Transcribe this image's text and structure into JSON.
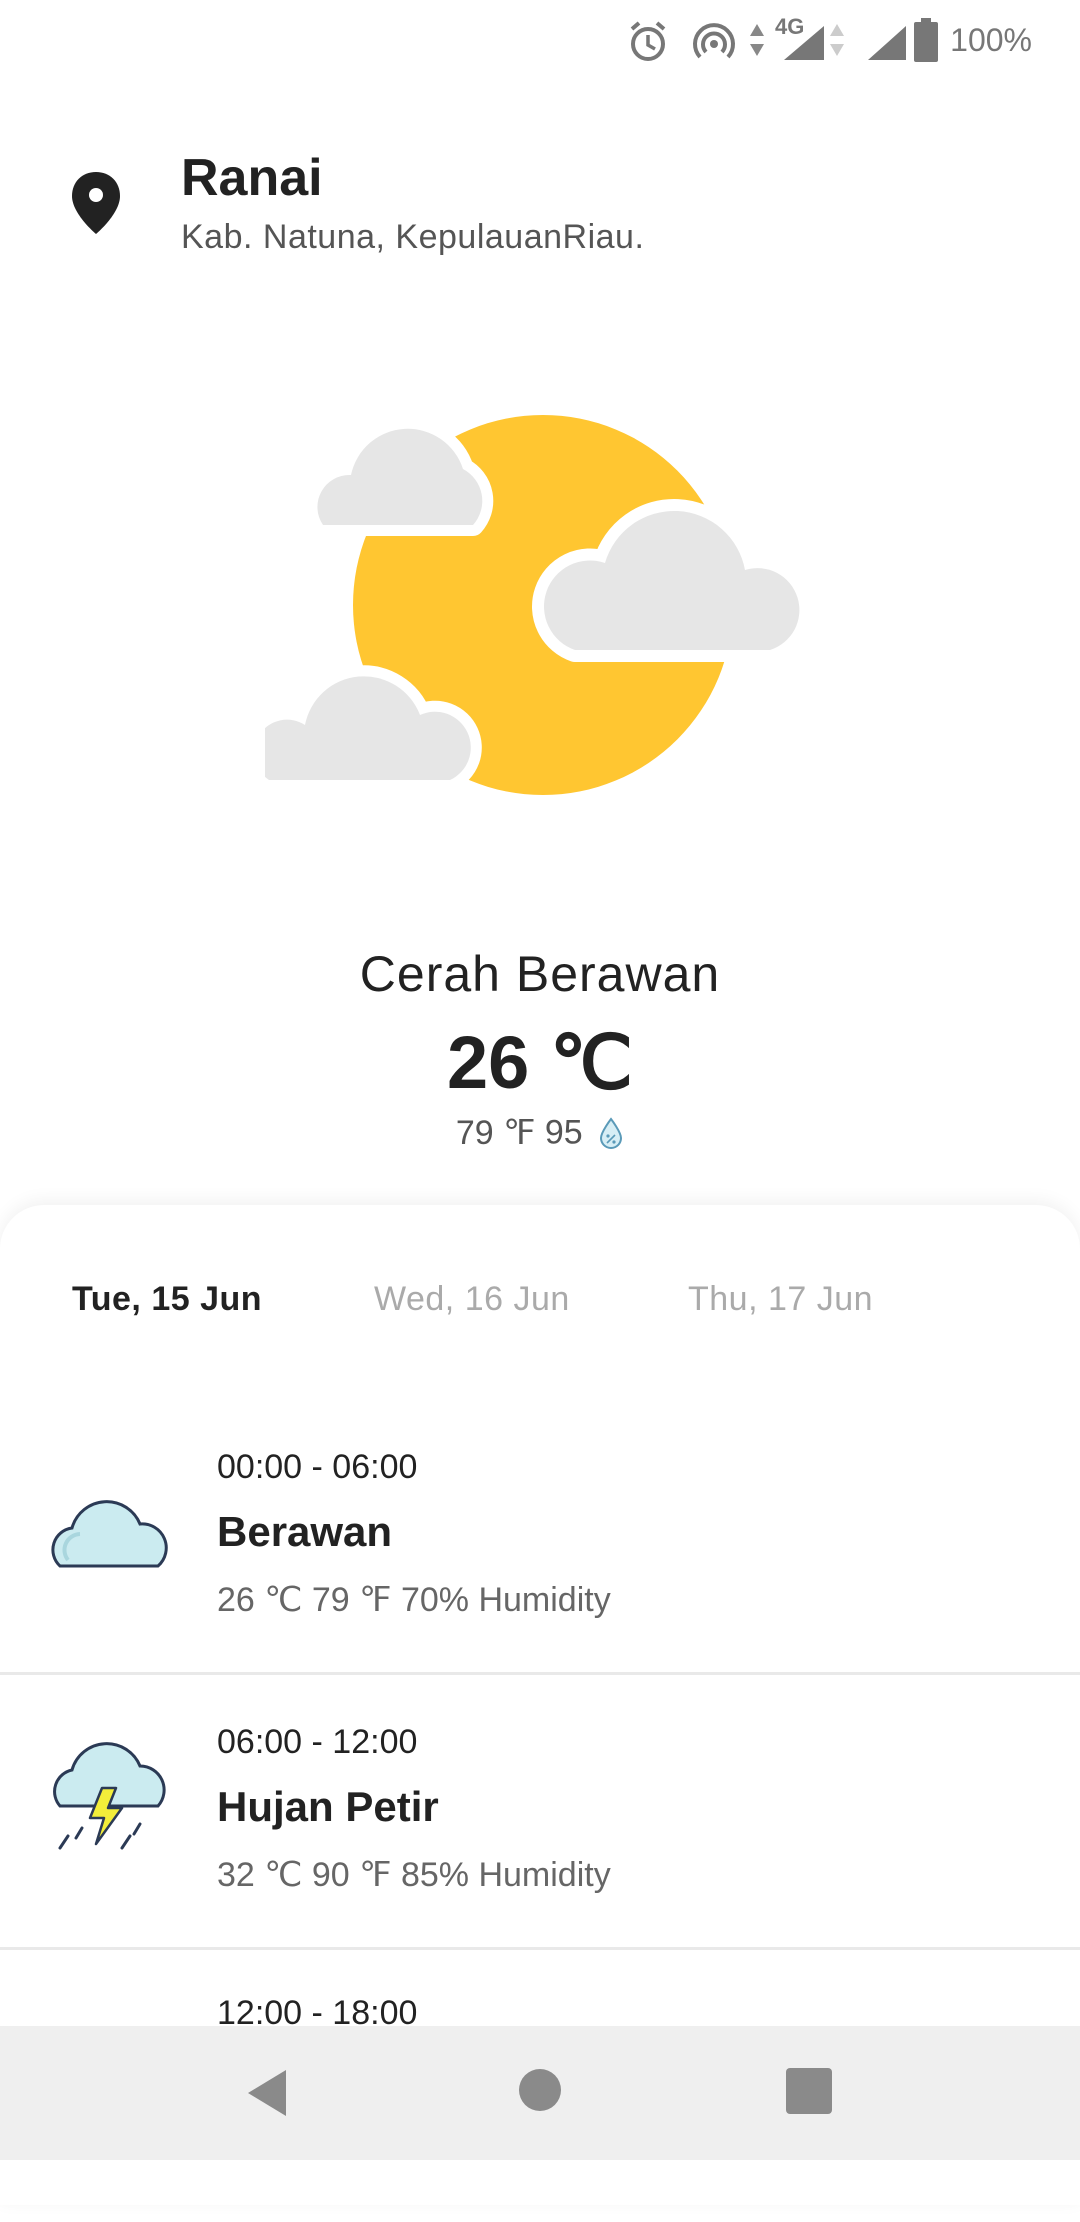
{
  "status_bar": {
    "network": "4G",
    "battery": "100%",
    "icons": [
      "alarm-icon",
      "hotspot-icon",
      "data-arrows-icon",
      "signal-icon",
      "battery-icon"
    ]
  },
  "location": {
    "city": "Ranai",
    "region": "Kab. Natuna, KepulauanRiau.",
    "icon": "map-pin-icon"
  },
  "current": {
    "icon": "partly-cloudy-sun-icon",
    "condition": "Cerah Berawan",
    "temp_c": "26 ℃",
    "temp_f": "79 ℉",
    "humidity": "95",
    "humidity_icon": "humidity-drop-icon"
  },
  "tabs": [
    {
      "label": "Tue, 15 Jun",
      "active": true
    },
    {
      "label": "Wed, 16 Jun",
      "active": false
    },
    {
      "label": "Thu, 17 Jun",
      "active": false
    }
  ],
  "forecast": [
    {
      "time": "00:00 - 06:00",
      "desc": "Berawan",
      "detail": "26 ℃ 79 ℉ 70% Humidity",
      "icon": "cloud-icon"
    },
    {
      "time": "06:00 - 12:00",
      "desc": "Hujan Petir",
      "detail": "32 ℃ 90 ℉ 85% Humidity",
      "icon": "thunderstorm-icon"
    },
    {
      "time": "12:00 - 18:00",
      "desc": "",
      "detail": "",
      "icon": "cloud-icon"
    }
  ],
  "nav": [
    "back-icon",
    "home-icon",
    "recents-icon"
  ],
  "colors": {
    "sun": "#FFC631",
    "cloud": "#E6E6E6",
    "icon_cloud": "#CBEBF0",
    "icon_outline": "#2B3A55",
    "bolt": "#F3EE3A",
    "muted_text": "#AAAAAA"
  }
}
